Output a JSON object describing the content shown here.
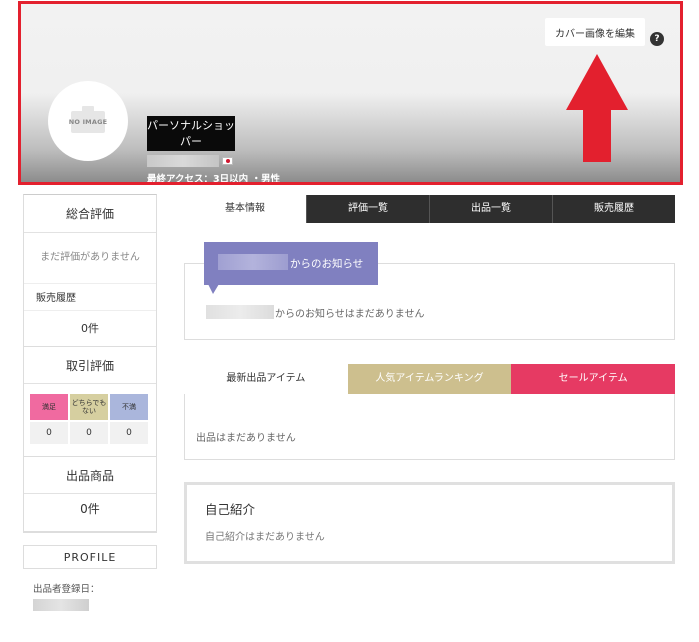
{
  "cover": {
    "edit_button": "カバー画像を編集",
    "help_glyph": "?",
    "avatar_text": "NO IMAGE",
    "shop_name": "パーソナルショッパー",
    "last_access": "最終アクセス：3日以内 ・男性",
    "accent_color": "#e3202e"
  },
  "sidebar": {
    "overall_title": "総合評価",
    "overall_empty": "まだ評価がありません",
    "sales_history_label": "販売履歴",
    "sales_history_count": "0件",
    "trade_title": "取引評価",
    "eval_headers": [
      "満足",
      "どちらでもない",
      "不満"
    ],
    "eval_values": [
      "0",
      "0",
      "0"
    ],
    "products_title": "出品商品",
    "products_count": "0件",
    "profile_title": "PROFILE",
    "registration_label": "出品者登録日："
  },
  "tabs": [
    "基本情報",
    "評価一覧",
    "出品一覧",
    "販売履歴"
  ],
  "notice": {
    "tag_suffix": "からのお知らせ",
    "empty_text": "からのお知らせはまだありません"
  },
  "item_tabs": [
    "最新出品アイテム",
    "人気アイテムランキング",
    "セールアイテム"
  ],
  "items_empty": "出品はまだありません",
  "intro": {
    "title": "自己紹介",
    "empty_text": "自己紹介はまだありません"
  }
}
